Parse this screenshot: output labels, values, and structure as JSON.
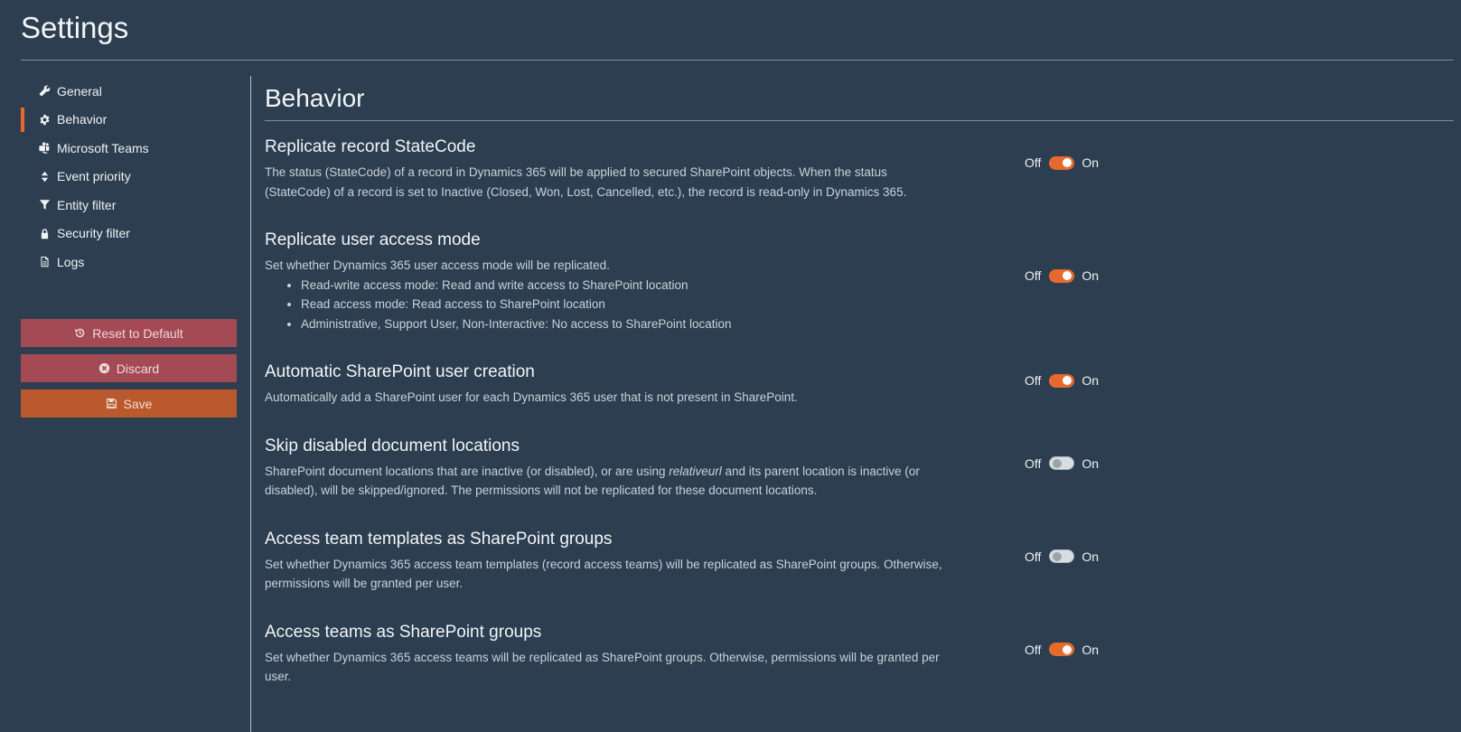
{
  "page": {
    "title": "Settings"
  },
  "sidebar": {
    "items": [
      {
        "label": "General",
        "icon": "wrench-icon",
        "active": false
      },
      {
        "label": "Behavior",
        "icon": "gear-icon",
        "active": true
      },
      {
        "label": "Microsoft Teams",
        "icon": "teams-icon",
        "active": false
      },
      {
        "label": "Event priority",
        "icon": "sort-icon",
        "active": false
      },
      {
        "label": "Entity filter",
        "icon": "filter-icon",
        "active": false
      },
      {
        "label": "Security filter",
        "icon": "lock-icon",
        "active": false
      },
      {
        "label": "Logs",
        "icon": "document-icon",
        "active": false
      }
    ],
    "actions": {
      "reset_label": "Reset to Default",
      "discard_label": "Discard",
      "save_label": "Save"
    }
  },
  "main": {
    "title": "Behavior",
    "settings": [
      {
        "title": "Replicate record StateCode",
        "description": "The status (StateCode) of a record in Dynamics 365 will be applied to secured SharePoint objects. When the status (StateCode) of a record is set to Inactive (Closed, Won, Lost, Cancelled, etc.), the record is read-only in Dynamics 365.",
        "enabled": true
      },
      {
        "title": "Replicate user access mode",
        "description": "Set whether Dynamics 365 user access mode will be replicated.",
        "bullets": [
          "Read-write access mode: Read and write access to SharePoint location",
          "Read access mode: Read access to SharePoint location",
          "Administrative, Support User, Non-Interactive: No access to SharePoint location"
        ],
        "enabled": true
      },
      {
        "title": "Automatic SharePoint user creation",
        "description": "Automatically add a SharePoint user for each Dynamics 365 user that is not present in SharePoint.",
        "enabled": true
      },
      {
        "title": "Skip disabled document locations",
        "description_before": "SharePoint document locations that are inactive (or disabled), or are using ",
        "description_emphasis": "relativeurl",
        "description_after": " and its parent location is inactive (or disabled), will be skipped/ignored. The permissions will not be replicated for these document locations.",
        "enabled": false
      },
      {
        "title": "Access team templates as SharePoint groups",
        "description": "Set whether Dynamics 365 access team templates (record access teams) will be replicated as SharePoint groups. Otherwise, permissions will be granted per user.",
        "enabled": false
      },
      {
        "title": "Access teams as SharePoint groups",
        "description": "Set whether Dynamics 365 access teams will be replicated as SharePoint groups. Otherwise, permissions will be granted per user.",
        "enabled": true
      }
    ],
    "toggle_off_label": "Off",
    "toggle_on_label": "On"
  },
  "colors": {
    "background": "#2c3e50",
    "accent": "#e8692e",
    "danger_button": "#a34a55",
    "save_button": "#b9592d"
  }
}
